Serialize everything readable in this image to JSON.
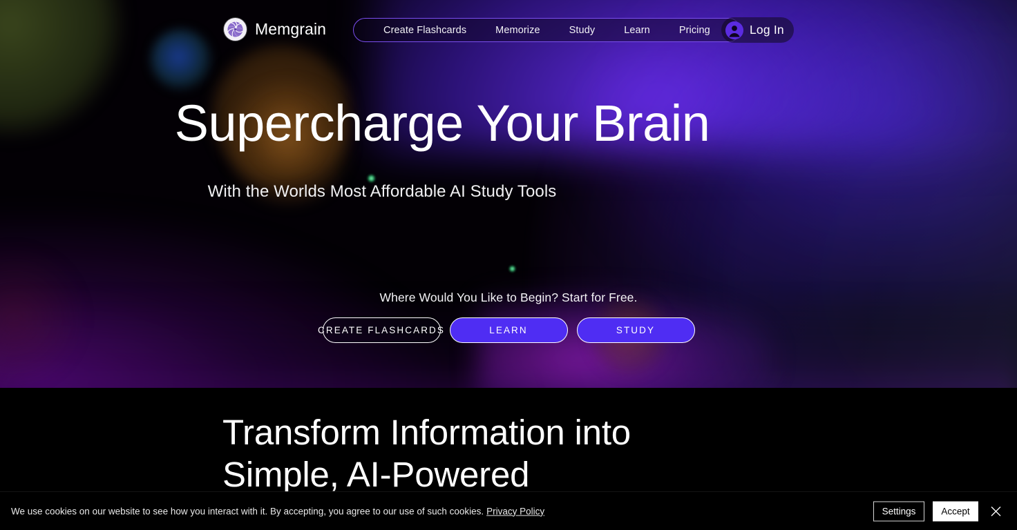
{
  "brand": {
    "name": "Memgrain",
    "logo_icon": "spiral-logo-icon",
    "logo_color": "#7b5bc4"
  },
  "nav": {
    "links": [
      {
        "label": "Create Flashcards"
      },
      {
        "label": "Memorize"
      },
      {
        "label": "Study"
      },
      {
        "label": "Learn"
      },
      {
        "label": "Pricing"
      }
    ],
    "border_color": "#7b4ef0",
    "login": {
      "label": "Log In",
      "avatar_icon": "user-avatar-icon",
      "avatar_color": "#5b2be0"
    }
  },
  "hero": {
    "heading": "Supercharge Your Brain",
    "subheading": "With the Worlds Most Affordable AI Study Tools",
    "cta_prompt": "Where Would You Like to Begin? Start for Free.",
    "buttons": [
      {
        "label": "CREATE FLASHCARDS",
        "style": "outline"
      },
      {
        "label": "LEARN",
        "style": "filled"
      },
      {
        "label": "STUDY",
        "style": "filled"
      }
    ],
    "accent_color": "#4f2df3",
    "mesh_color": "#a78bff"
  },
  "section2": {
    "title_line1": "Transform Information into",
    "title_line2": "Simple, AI-Powered"
  },
  "cookie_banner": {
    "message": "We use cookies on our website to see how you interact with it. By accepting, you agree to our use of such cookies.",
    "link_label": "Privacy Policy",
    "settings_label": "Settings",
    "accept_label": "Accept",
    "close_icon": "close-icon"
  }
}
